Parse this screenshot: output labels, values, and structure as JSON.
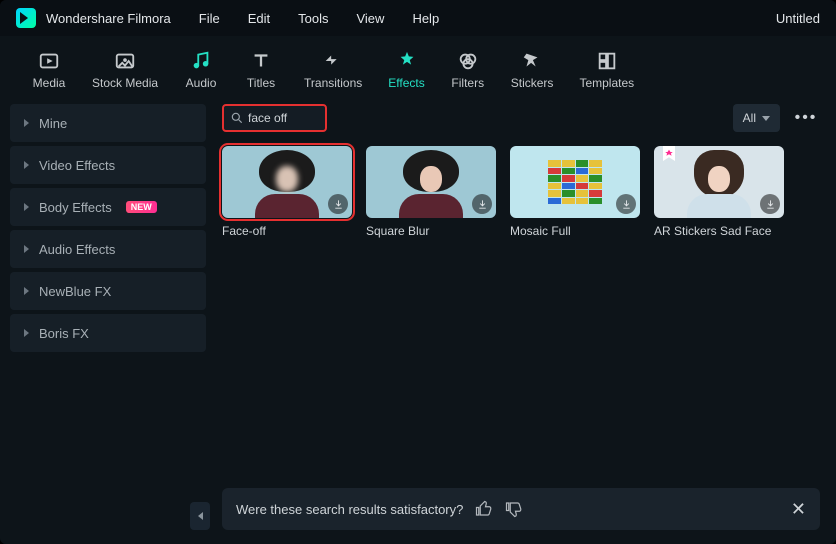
{
  "app": {
    "name": "Wondershare Filmora",
    "project_title": "Untitled"
  },
  "menu": [
    "File",
    "Edit",
    "Tools",
    "View",
    "Help"
  ],
  "toolbar": [
    {
      "id": "media",
      "label": "Media"
    },
    {
      "id": "stock-media",
      "label": "Stock Media"
    },
    {
      "id": "audio",
      "label": "Audio"
    },
    {
      "id": "titles",
      "label": "Titles"
    },
    {
      "id": "transitions",
      "label": "Transitions"
    },
    {
      "id": "effects",
      "label": "Effects",
      "active": true
    },
    {
      "id": "filters",
      "label": "Filters"
    },
    {
      "id": "stickers",
      "label": "Stickers"
    },
    {
      "id": "templates",
      "label": "Templates"
    }
  ],
  "sidebar": {
    "items": [
      {
        "label": "Mine"
      },
      {
        "label": "Video Effects"
      },
      {
        "label": "Body Effects",
        "badge": "NEW"
      },
      {
        "label": "Audio Effects"
      },
      {
        "label": "NewBlue FX"
      },
      {
        "label": "Boris FX"
      }
    ]
  },
  "search": {
    "value": "face off"
  },
  "filter": {
    "label": "All"
  },
  "results": [
    {
      "label": "Face-off",
      "selected": true,
      "kind": "face-blur"
    },
    {
      "label": "Square Blur",
      "kind": "face-clear"
    },
    {
      "label": "Mosaic Full",
      "kind": "mosaic"
    },
    {
      "label": "AR Stickers Sad Face",
      "kind": "face-clear",
      "favorite": true
    }
  ],
  "feedback": {
    "prompt": "Were these search results satisfactory?"
  }
}
